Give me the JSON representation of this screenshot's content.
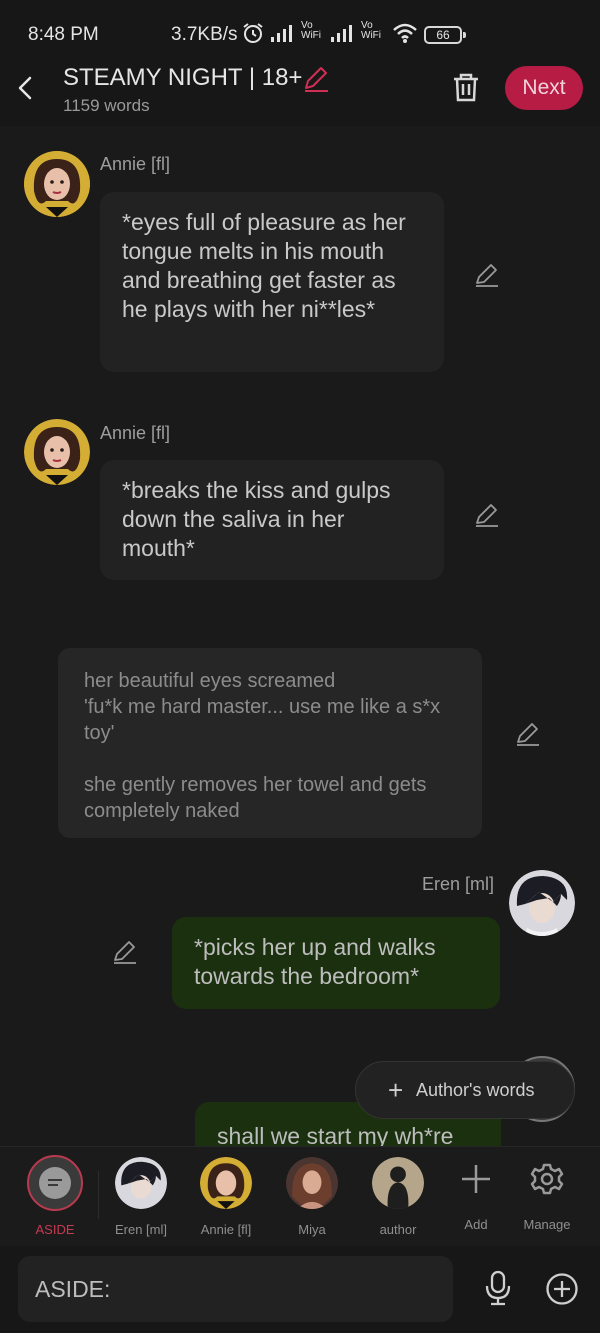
{
  "status_bar": {
    "time": "8:48 PM",
    "net_speed": "3.7KB/s",
    "vo_label": "Vo",
    "wifi_label": "WiFi",
    "battery": "66"
  },
  "header": {
    "title": "STEAMY NIGHT | 18+",
    "word_count": "1159 words",
    "next_label": "Next"
  },
  "messages": [
    {
      "sender": "Annie [fl]",
      "text": "*eyes full of pleasure as her tongue melts in his mouth and breathing get faster as he plays with her ni**les*"
    },
    {
      "sender": "Annie [fl]",
      "text": "*breaks the kiss and gulps down the saliva in her mouth*"
    },
    {
      "narration_line1": "her beautiful eyes screamed",
      "narration_line2": "'fu*k me hard master... use me like a s*x toy'",
      "narration_line3": "she gently removes her towel and gets completely naked"
    },
    {
      "sender": "Eren [ml]",
      "text": "*picks her up and walks towards the bedroom*"
    },
    {
      "text": "shall we start my wh*re"
    }
  ],
  "authors_words_label": "Author's words",
  "characters": [
    {
      "name": "ASIDE"
    },
    {
      "name": "Eren [ml]"
    },
    {
      "name": "Annie [fl]"
    },
    {
      "name": "Miya"
    },
    {
      "name": "author"
    },
    {
      "name": "Add"
    },
    {
      "name": "Manage"
    }
  ],
  "input": {
    "placeholder": "ASIDE:"
  },
  "colors": {
    "accent": "#b71c45",
    "user_bubble": "#1b300f",
    "bubble": "#222222"
  },
  "icons": [
    "back-arrow-icon",
    "pencil-icon",
    "trash-icon",
    "plus-icon",
    "gear-icon",
    "microphone-icon",
    "plus-circle-icon"
  ]
}
